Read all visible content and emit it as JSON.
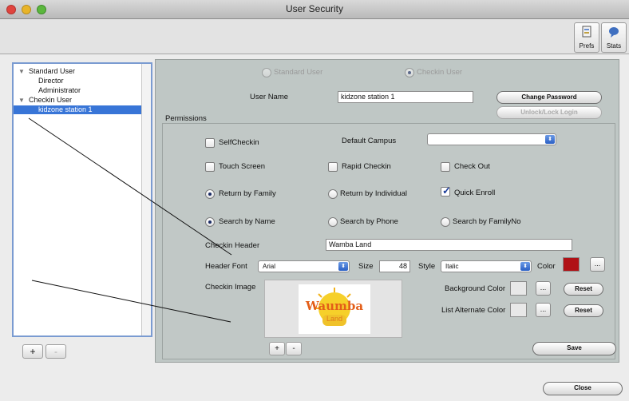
{
  "window": {
    "title": "User Security"
  },
  "toolbar": {
    "prefs": "Prefs",
    "stats": "Stats"
  },
  "tree": {
    "items": [
      {
        "label": "Standard User",
        "group": true
      },
      {
        "label": "Director",
        "group": false
      },
      {
        "label": "Administrator",
        "group": false
      },
      {
        "label": "Checkin User",
        "group": true
      },
      {
        "label": "kidzone station 1",
        "group": false,
        "selected": true
      }
    ],
    "add_label": "+",
    "remove_label": "-"
  },
  "user_type": {
    "standard": "Standard User",
    "checkin": "Checkin User",
    "selected": "checkin"
  },
  "user_name": {
    "label": "User Name",
    "value": "kidzone station 1"
  },
  "buttons": {
    "change_password": "Change Password",
    "unlock_login": "Unlock/Lock Login",
    "save": "Save",
    "close": "Close",
    "reset": "Reset",
    "ellipsis": "..."
  },
  "permissions": {
    "title": "Permissions",
    "self_checkin": "SelfCheckin",
    "default_campus": "Default Campus",
    "default_campus_value": "",
    "touch_screen": "Touch Screen",
    "rapid_checkin": "Rapid Checkin",
    "check_out": "Check Out",
    "return_by_family": "Return by Family",
    "return_by_individual": "Return by Individual",
    "quick_enroll": "Quick Enroll",
    "search_by_name": "Search by Name",
    "search_by_phone": "Search by Phone",
    "search_by_familyno": "Search by FamilyNo",
    "checkin_header": "Checkin Header",
    "checkin_header_value": "Wamba Land",
    "header_font": "Header Font",
    "header_font_value": "Arial",
    "size": "Size",
    "size_value": "48",
    "style": "Style",
    "style_value": "Italic",
    "color": "Color",
    "color_value": "#b01116",
    "checkin_image": "Checkin Image",
    "background_color": "Background Color",
    "list_alternate_color": "List Alternate Color"
  },
  "logo": {
    "line1": "Waumba",
    "line2": "Land"
  },
  "image_controls": {
    "add": "+",
    "remove": "-"
  }
}
